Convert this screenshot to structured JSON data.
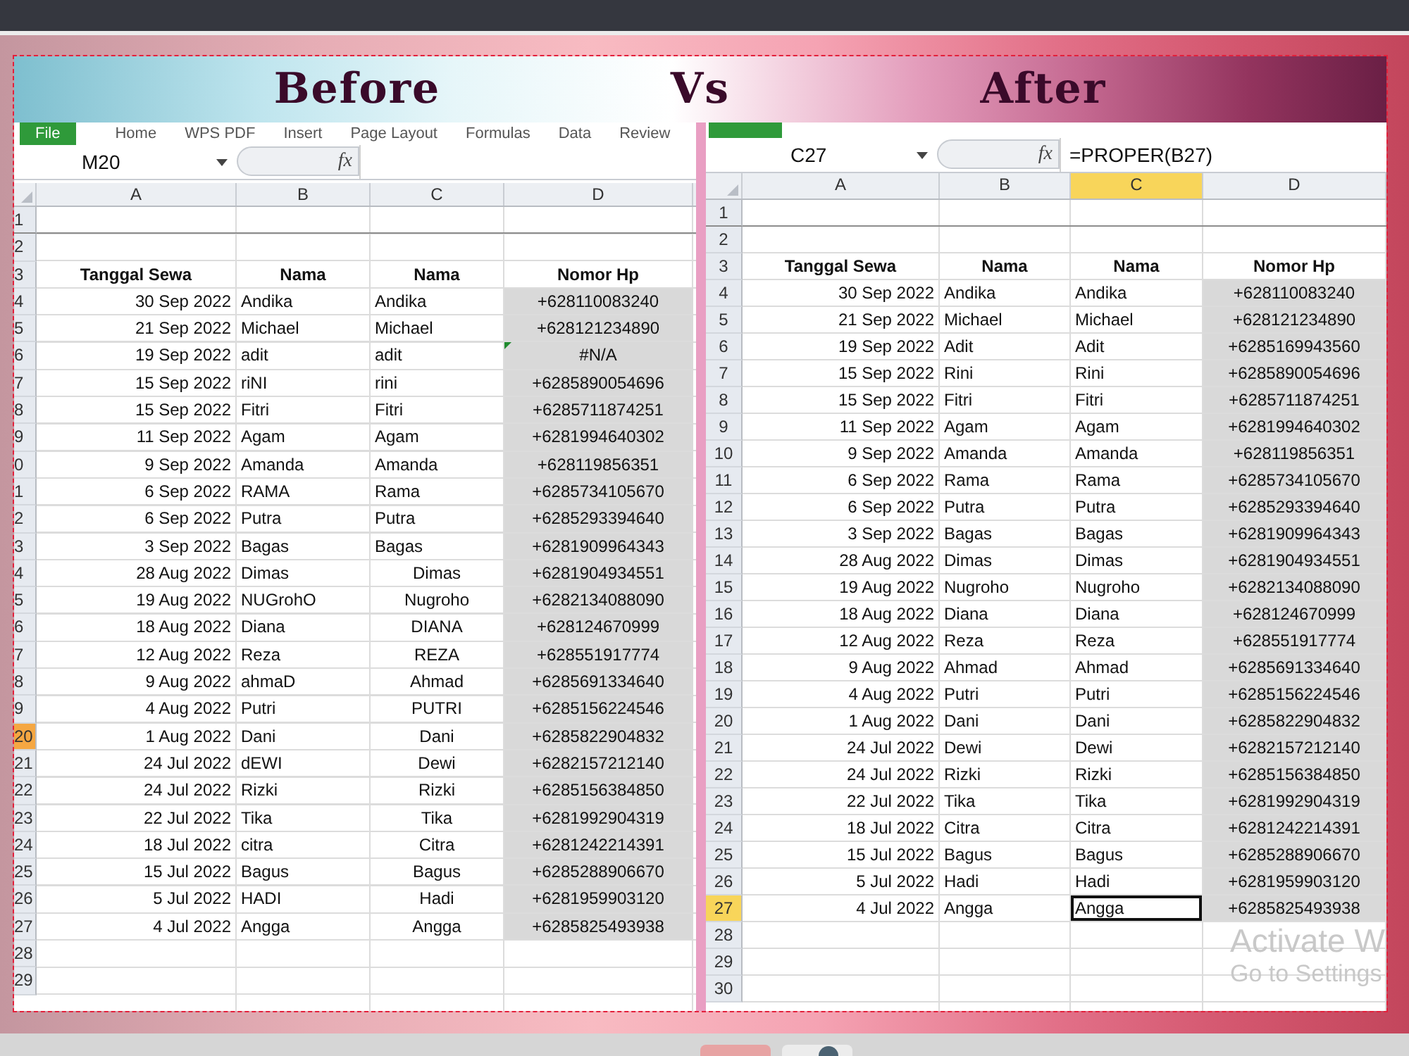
{
  "banner": {
    "titles": [
      "Before",
      "Vs",
      "After"
    ]
  },
  "sheets": [
    {
      "ribbon_tabs": [
        {
          "kind": "file",
          "label": "File"
        },
        {
          "kind": "tab",
          "label": "Home"
        },
        {
          "kind": "tab",
          "label": "WPS PDF"
        },
        {
          "kind": "tab",
          "label": "Insert"
        },
        {
          "kind": "tab",
          "label": "Page Layout"
        },
        {
          "kind": "tab",
          "label": "Formulas"
        },
        {
          "kind": "tab",
          "label": "Data"
        },
        {
          "kind": "tab",
          "label": "Review"
        }
      ],
      "name_box": "M20",
      "function_label": "fx",
      "columns": [
        {
          "label": "A",
          "selected": false
        },
        {
          "label": "B",
          "selected": false
        },
        {
          "label": "C",
          "selected": false
        },
        {
          "label": "D",
          "selected": false
        }
      ],
      "rows": [
        {
          "number": "1",
          "selected": false,
          "kind": "empty"
        },
        {
          "number": "2",
          "selected": false,
          "kind": "empty"
        },
        {
          "number": "3",
          "selected": false,
          "kind": "header",
          "cells": [
            "Tanggal Sewa",
            "Nama",
            "Nama",
            "Nomor Hp"
          ]
        },
        {
          "number": "4",
          "selected": false,
          "kind": "data",
          "cells": [
            "30 Sep 2022",
            "Andika",
            "Andika",
            "+628110083240"
          ],
          "c_centered": false,
          "error_flag": false
        },
        {
          "number": "5",
          "selected": false,
          "kind": "data",
          "cells": [
            "21 Sep 2022",
            "Michael",
            "Michael",
            "+628121234890"
          ],
          "c_centered": false,
          "error_flag": false
        },
        {
          "number": "6",
          "selected": false,
          "kind": "data",
          "cells": [
            "19 Sep 2022",
            "adit",
            "adit",
            "#N/A"
          ],
          "c_centered": false,
          "error_flag": true
        },
        {
          "number": "7",
          "selected": false,
          "kind": "data",
          "cells": [
            "15 Sep 2022",
            "riNI",
            "rini",
            "+6285890054696"
          ],
          "c_centered": false,
          "error_flag": false
        },
        {
          "number": "8",
          "selected": false,
          "kind": "data",
          "cells": [
            "15 Sep 2022",
            "Fitri",
            "Fitri",
            "+6285711874251"
          ],
          "c_centered": false,
          "error_flag": false
        },
        {
          "number": "9",
          "selected": false,
          "kind": "data",
          "cells": [
            "11 Sep 2022",
            "Agam",
            "Agam",
            "+6281994640302"
          ],
          "c_centered": false,
          "error_flag": false
        },
        {
          "number": "0",
          "selected": false,
          "kind": "data",
          "cells": [
            "9 Sep 2022",
            "Amanda",
            "Amanda",
            "+628119856351"
          ],
          "c_centered": false,
          "error_flag": false
        },
        {
          "number": "1",
          "selected": false,
          "kind": "data",
          "cells": [
            "6 Sep 2022",
            "RAMA",
            "Rama",
            "+6285734105670"
          ],
          "c_centered": false,
          "error_flag": false
        },
        {
          "number": "2",
          "selected": false,
          "kind": "data",
          "cells": [
            "6 Sep 2022",
            "Putra",
            "Putra",
            "+6285293394640"
          ],
          "c_centered": false,
          "error_flag": false
        },
        {
          "number": "3",
          "selected": false,
          "kind": "data",
          "cells": [
            "3 Sep 2022",
            "Bagas",
            "Bagas",
            "+6281909964343"
          ],
          "c_centered": false,
          "error_flag": false
        },
        {
          "number": "4",
          "selected": false,
          "kind": "data",
          "cells": [
            "28 Aug 2022",
            "Dimas",
            "Dimas",
            "+6281904934551"
          ],
          "c_centered": true,
          "error_flag": false
        },
        {
          "number": "5",
          "selected": false,
          "kind": "data",
          "cells": [
            "19 Aug 2022",
            "NUGrohO",
            "Nugroho",
            "+6282134088090"
          ],
          "c_centered": true,
          "error_flag": false
        },
        {
          "number": "6",
          "selected": false,
          "kind": "data",
          "cells": [
            "18 Aug 2022",
            "Diana",
            "DIANA",
            "+628124670999"
          ],
          "c_centered": true,
          "error_flag": false
        },
        {
          "number": "7",
          "selected": false,
          "kind": "data",
          "cells": [
            "12 Aug 2022",
            "Reza",
            "REZA",
            "+628551917774"
          ],
          "c_centered": true,
          "error_flag": false
        },
        {
          "number": "8",
          "selected": false,
          "kind": "data",
          "cells": [
            "9 Aug 2022",
            "ahmaD",
            "Ahmad",
            "+6285691334640"
          ],
          "c_centered": true,
          "error_flag": false
        },
        {
          "number": "9",
          "selected": false,
          "kind": "data",
          "cells": [
            "4 Aug 2022",
            "Putri",
            "PUTRI",
            "+6285156224546"
          ],
          "c_centered": true,
          "error_flag": false
        },
        {
          "number": "20",
          "selected": true,
          "kind": "data",
          "cells": [
            "1 Aug 2022",
            "Dani",
            "Dani",
            "+6285822904832"
          ],
          "c_centered": true,
          "error_flag": false
        },
        {
          "number": "21",
          "selected": false,
          "kind": "data",
          "cells": [
            "24 Jul 2022",
            "dEWI",
            "Dewi",
            "+6282157212140"
          ],
          "c_centered": true,
          "error_flag": false
        },
        {
          "number": "22",
          "selected": false,
          "kind": "data",
          "cells": [
            "24 Jul 2022",
            "Rizki",
            "Rizki",
            "+6285156384850"
          ],
          "c_centered": true,
          "error_flag": false
        },
        {
          "number": "23",
          "selected": false,
          "kind": "data",
          "cells": [
            "22 Jul 2022",
            "Tika",
            "Tika",
            "+6281992904319"
          ],
          "c_centered": true,
          "error_flag": false
        },
        {
          "number": "24",
          "selected": false,
          "kind": "data",
          "cells": [
            "18 Jul 2022",
            "citra",
            "Citra",
            "+6281242214391"
          ],
          "c_centered": true,
          "error_flag": false
        },
        {
          "number": "25",
          "selected": false,
          "kind": "data",
          "cells": [
            "15 Jul 2022",
            "Bagus",
            "Bagus",
            "+6285288906670"
          ],
          "c_centered": true,
          "error_flag": false
        },
        {
          "number": "26",
          "selected": false,
          "kind": "data",
          "cells": [
            "5 Jul 2022",
            "HADI",
            "Hadi",
            "+6281959903120"
          ],
          "c_centered": true,
          "error_flag": false
        },
        {
          "number": "27",
          "selected": false,
          "kind": "data",
          "cells": [
            "4 Jul 2022",
            "Angga",
            "Angga",
            "+6285825493938"
          ],
          "c_centered": true,
          "error_flag": false
        },
        {
          "number": "28",
          "selected": false,
          "kind": "empty"
        },
        {
          "number": "29",
          "selected": false,
          "kind": "empty"
        }
      ]
    },
    {
      "ribbon_tabs": [
        {
          "kind": "file"
        }
      ],
      "name_box": "C27",
      "function_label": "fx",
      "formula": "=PROPER(B27)",
      "columns": [
        {
          "label": "A",
          "selected": false
        },
        {
          "label": "B",
          "selected": false
        },
        {
          "label": "C",
          "selected": true
        },
        {
          "label": "D",
          "selected": false
        }
      ],
      "rows": [
        {
          "number": "1",
          "selected": false,
          "kind": "empty"
        },
        {
          "number": "2",
          "selected": false,
          "kind": "empty"
        },
        {
          "number": "3",
          "selected": false,
          "kind": "header",
          "cells": [
            "Tanggal Sewa",
            "Nama",
            "Nama",
            "Nomor Hp"
          ]
        },
        {
          "number": "4",
          "selected": false,
          "kind": "data",
          "cells": [
            "30 Sep 2022",
            "Andika",
            "Andika",
            "+628110083240"
          ]
        },
        {
          "number": "5",
          "selected": false,
          "kind": "data",
          "cells": [
            "21 Sep 2022",
            "Michael",
            "Michael",
            "+628121234890"
          ]
        },
        {
          "number": "6",
          "selected": false,
          "kind": "data",
          "cells": [
            "19 Sep 2022",
            "Adit",
            "Adit",
            "+6285169943560"
          ]
        },
        {
          "number": "7",
          "selected": false,
          "kind": "data",
          "cells": [
            "15 Sep 2022",
            "Rini",
            "Rini",
            "+6285890054696"
          ]
        },
        {
          "number": "8",
          "selected": false,
          "kind": "data",
          "cells": [
            "15 Sep 2022",
            "Fitri",
            "Fitri",
            "+6285711874251"
          ]
        },
        {
          "number": "9",
          "selected": false,
          "kind": "data",
          "cells": [
            "11 Sep 2022",
            "Agam",
            "Agam",
            "+6281994640302"
          ]
        },
        {
          "number": "10",
          "selected": false,
          "kind": "data",
          "cells": [
            "9 Sep 2022",
            "Amanda",
            "Amanda",
            "+628119856351"
          ]
        },
        {
          "number": "11",
          "selected": false,
          "kind": "data",
          "cells": [
            "6 Sep 2022",
            "Rama",
            "Rama",
            "+6285734105670"
          ]
        },
        {
          "number": "12",
          "selected": false,
          "kind": "data",
          "cells": [
            "6 Sep 2022",
            "Putra",
            "Putra",
            "+6285293394640"
          ]
        },
        {
          "number": "13",
          "selected": false,
          "kind": "data",
          "cells": [
            "3 Sep 2022",
            "Bagas",
            "Bagas",
            "+6281909964343"
          ]
        },
        {
          "number": "14",
          "selected": false,
          "kind": "data",
          "cells": [
            "28 Aug 2022",
            "Dimas",
            "Dimas",
            "+6281904934551"
          ]
        },
        {
          "number": "15",
          "selected": false,
          "kind": "data",
          "cells": [
            "19 Aug 2022",
            "Nugroho",
            "Nugroho",
            "+6282134088090"
          ]
        },
        {
          "number": "16",
          "selected": false,
          "kind": "data",
          "cells": [
            "18 Aug 2022",
            "Diana",
            "Diana",
            "+628124670999"
          ]
        },
        {
          "number": "17",
          "selected": false,
          "kind": "data",
          "cells": [
            "12 Aug 2022",
            "Reza",
            "Reza",
            "+628551917774"
          ]
        },
        {
          "number": "18",
          "selected": false,
          "kind": "data",
          "cells": [
            "9 Aug 2022",
            "Ahmad",
            "Ahmad",
            "+6285691334640"
          ]
        },
        {
          "number": "19",
          "selected": false,
          "kind": "data",
          "cells": [
            "4 Aug 2022",
            "Putri",
            "Putri",
            "+6285156224546"
          ]
        },
        {
          "number": "20",
          "selected": false,
          "kind": "data",
          "cells": [
            "1 Aug 2022",
            "Dani",
            "Dani",
            "+6285822904832"
          ]
        },
        {
          "number": "21",
          "selected": false,
          "kind": "data",
          "cells": [
            "24 Jul 2022",
            "Dewi",
            "Dewi",
            "+6282157212140"
          ]
        },
        {
          "number": "22",
          "selected": false,
          "kind": "data",
          "cells": [
            "24 Jul 2022",
            "Rizki",
            "Rizki",
            "+6285156384850"
          ]
        },
        {
          "number": "23",
          "selected": false,
          "kind": "data",
          "cells": [
            "22 Jul 2022",
            "Tika",
            "Tika",
            "+6281992904319"
          ]
        },
        {
          "number": "24",
          "selected": false,
          "kind": "data",
          "cells": [
            "18 Jul 2022",
            "Citra",
            "Citra",
            "+6281242214391"
          ]
        },
        {
          "number": "25",
          "selected": false,
          "kind": "data",
          "cells": [
            "15 Jul 2022",
            "Bagus",
            "Bagus",
            "+6285288906670"
          ]
        },
        {
          "number": "26",
          "selected": false,
          "kind": "data",
          "cells": [
            "5 Jul 2022",
            "Hadi",
            "Hadi",
            "+6281959903120"
          ]
        },
        {
          "number": "27",
          "selected": true,
          "kind": "data",
          "cells": [
            "4 Jul 2022",
            "Angga",
            "Angga",
            "+6285825493938"
          ]
        },
        {
          "number": "28",
          "selected": false,
          "kind": "empty"
        },
        {
          "number": "29",
          "selected": false,
          "kind": "empty"
        },
        {
          "number": "30",
          "selected": false,
          "kind": "empty"
        }
      ]
    }
  ],
  "activation_notice": {
    "title": "Activate W",
    "subtitle": "Go to Settings"
  }
}
